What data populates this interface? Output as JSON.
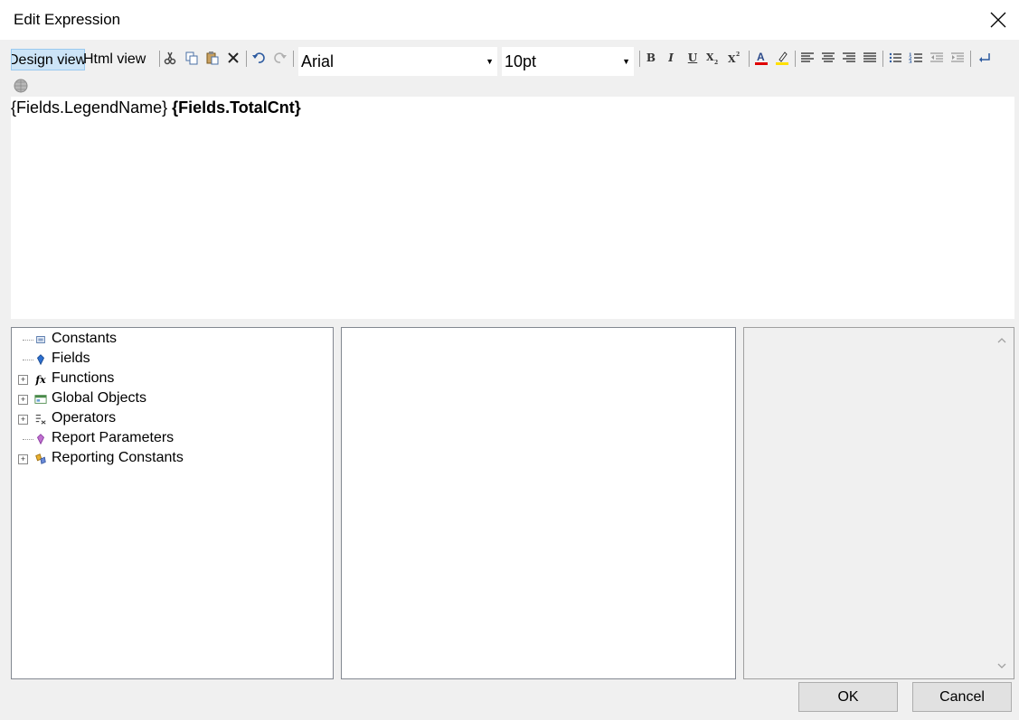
{
  "window": {
    "title": "Edit Expression"
  },
  "toolbar": {
    "tabs": {
      "design": "Design view",
      "html": "Html view"
    },
    "font_name": "Arial",
    "font_size": "10pt",
    "bold": "B",
    "italic": "I",
    "underline": "U",
    "subscript": "X2",
    "superscript": "X2"
  },
  "editor": {
    "segments": [
      {
        "text": "{Fields.LegendName} ",
        "bold": false
      },
      {
        "text": "{Fields.TotalCnt}",
        "bold": true
      }
    ]
  },
  "tree": {
    "items": [
      {
        "label": "Constants",
        "icon": "constants-icon",
        "expandable": false
      },
      {
        "label": "Fields",
        "icon": "fields-icon",
        "expandable": false
      },
      {
        "label": "Functions",
        "icon": "functions-icon",
        "expandable": true
      },
      {
        "label": "Global Objects",
        "icon": "global-objects-icon",
        "expandable": true
      },
      {
        "label": "Operators",
        "icon": "operators-icon",
        "expandable": true
      },
      {
        "label": "Report Parameters",
        "icon": "report-parameters-icon",
        "expandable": false
      },
      {
        "label": "Reporting Constants",
        "icon": "reporting-constants-icon",
        "expandable": true
      }
    ]
  },
  "buttons": {
    "ok": "OK",
    "cancel": "Cancel"
  },
  "colors": {
    "font_color": "#e00000",
    "highlight": "#ffe000",
    "tab_selected": "#cce4f7"
  }
}
